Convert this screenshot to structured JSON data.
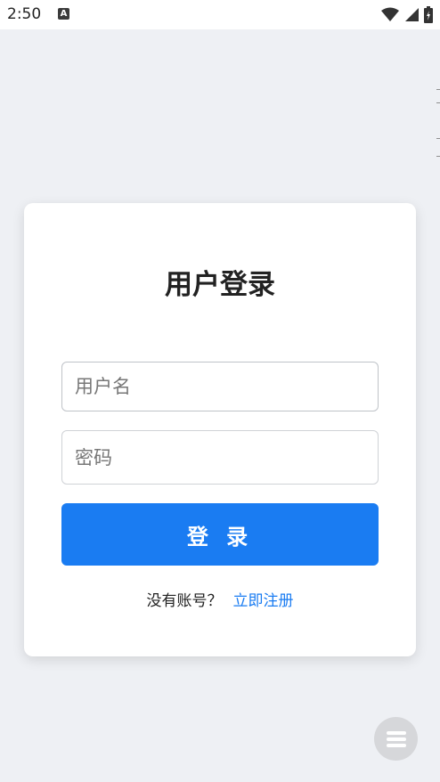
{
  "status_bar": {
    "time": "2:50",
    "app_icon_letter": "A"
  },
  "login_card": {
    "title": "用户登录",
    "username_placeholder": "用户名",
    "password_placeholder": "密码",
    "login_button_label": "登 录",
    "no_account_text": "没有账号？",
    "register_link_text": "立即注册"
  },
  "colors": {
    "background": "#eef0f4",
    "primary": "#1a7cf2"
  },
  "icons": [
    "wifi-icon",
    "signal-icon",
    "battery-icon",
    "menu-icon"
  ]
}
